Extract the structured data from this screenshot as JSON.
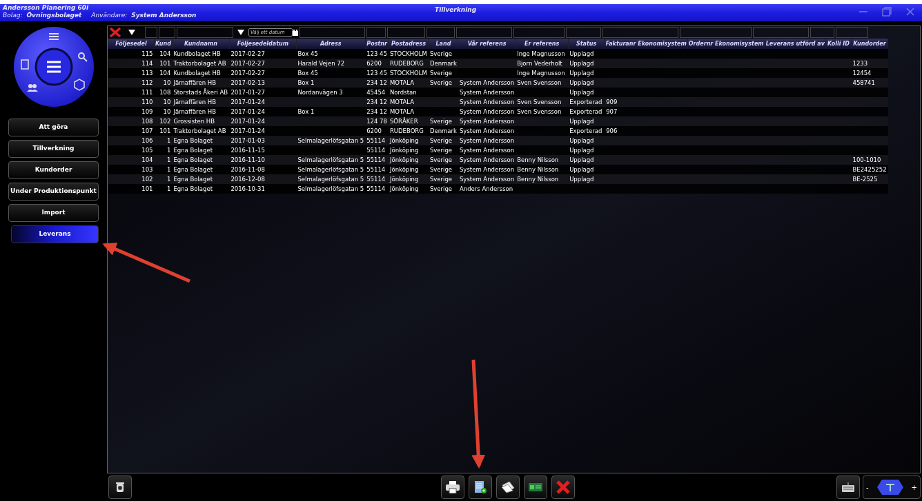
{
  "window": {
    "app_name": "Andersson Planering 60i",
    "company_label": "Bolag:",
    "company": "Övningsbolaget",
    "user_label": "Användare:",
    "user": "System Andersson",
    "title": "Tillverkning"
  },
  "sidebar": {
    "items": [
      {
        "label": "Att göra",
        "selected": false
      },
      {
        "label": "Tillverkning",
        "selected": false
      },
      {
        "label": "Kundorder",
        "selected": false
      },
      {
        "label": "Under Produktionspunkt",
        "selected": false
      },
      {
        "label": "Import",
        "selected": false
      },
      {
        "label": "Leverans",
        "selected": true
      }
    ]
  },
  "filter": {
    "date_placeholder": "Välj ett datum"
  },
  "table": {
    "columns": [
      "Följesedel",
      "Kund",
      "Kundnamn",
      "Följesedeldatum",
      "Adress",
      "Postnr",
      "Postadress",
      "Land",
      "Vår referens",
      "Er referens",
      "Status",
      "Fakturanr Ekonomisystem",
      "Ordernr Ekonomisystem",
      "Leverans utförd av",
      "Kolli ID",
      "Kundorder"
    ],
    "rows": [
      [
        "115",
        "104",
        "Kundbolaget HB",
        "2017-02-27",
        "Box 45",
        "123 45",
        "STOCKHOLM",
        "Sverige",
        "",
        "Inge Magnusson",
        "Upplagd",
        "",
        "",
        "",
        "",
        ""
      ],
      [
        "114",
        "101",
        "Traktorbolaget AB",
        "2017-02-27",
        "Harald Vejen 72",
        "6200",
        "RUDEBORG",
        "Denmark",
        "",
        "Bjorn Vederholt",
        "Upplagd",
        "",
        "",
        "",
        "",
        "1233"
      ],
      [
        "113",
        "104",
        "Kundbolaget HB",
        "2017-02-27",
        "Box 45",
        "123 45",
        "STOCKHOLM",
        "Sverige",
        "",
        "Inge Magnusson",
        "Upplagd",
        "",
        "",
        "",
        "",
        "12454"
      ],
      [
        "112",
        "10",
        "Järnaffären HB",
        "2017-02-13",
        "Box 1",
        "234 12",
        "MOTALA",
        "Sverige",
        "System Andersson",
        "Sven Svensson",
        "Upplagd",
        "",
        "",
        "",
        "",
        "458741"
      ],
      [
        "111",
        "108",
        "Storstads Åkeri AB",
        "2017-01-27",
        "Nordanvägen 3",
        "45454",
        "Nordstan",
        "",
        "System Andersson",
        "",
        "Upplagd",
        "",
        "",
        "",
        "",
        ""
      ],
      [
        "110",
        "10",
        "Järnaffären HB",
        "2017-01-24",
        "",
        "234 12",
        "MOTALA",
        "",
        "System Andersson",
        "Sven Svensson",
        "Exporterad",
        "909",
        "",
        "",
        "",
        ""
      ],
      [
        "109",
        "10",
        "Järnaffären HB",
        "2017-01-24",
        "Box 1",
        "234 12",
        "MOTALA",
        "",
        "System Andersson",
        "Sven Svensson",
        "Exporterad",
        "907",
        "",
        "",
        "",
        ""
      ],
      [
        "108",
        "102",
        "Grossisten HB",
        "2017-01-24",
        "",
        "124 78",
        "SÖRÅKER",
        "Sverige",
        "System Andersson",
        "",
        "Upplagd",
        "",
        "",
        "",
        "",
        ""
      ],
      [
        "107",
        "101",
        "Traktorbolaget AB",
        "2017-01-24",
        "",
        "6200",
        "RUDEBORG",
        "Denmark",
        "System Andersson",
        "",
        "Exporterad",
        "906",
        "",
        "",
        "",
        ""
      ],
      [
        "106",
        "1",
        "Egna Bolaget",
        "2017-01-03",
        "Selmalagerlöfsgatan 5",
        "55114",
        "Jönköping",
        "Sverige",
        "System Andersson",
        "",
        "Upplagd",
        "",
        "",
        "",
        "",
        ""
      ],
      [
        "105",
        "1",
        "Egna Bolaget",
        "2016-11-15",
        "",
        "55114",
        "Jönköping",
        "Sverige",
        "System Andersson",
        "",
        "Upplagd",
        "",
        "",
        "",
        "",
        ""
      ],
      [
        "104",
        "1",
        "Egna Bolaget",
        "2016-11-10",
        "Selmalagerlöfsgatan 5",
        "55114",
        "Jönköping",
        "Sverige",
        "System Andersson",
        "Benny Nilsson",
        "Upplagd",
        "",
        "",
        "",
        "",
        "100-1010"
      ],
      [
        "103",
        "1",
        "Egna Bolaget",
        "2016-11-08",
        "Selmalagerlöfsgatan 5",
        "55114",
        "Jönköping",
        "Sverige",
        "System Andersson",
        "Benny Nilsson",
        "Upplagd",
        "",
        "",
        "",
        "",
        "BE2425252"
      ],
      [
        "102",
        "1",
        "Egna Bolaget",
        "2016-12-08",
        "Selmalagerlöfsgatan 5",
        "55114",
        "Jönköping",
        "Sverige",
        "System Andersson",
        "Benny Nilsson",
        "Upplagd",
        "",
        "",
        "",
        "",
        "BE-2525"
      ],
      [
        "101",
        "1",
        "Egna Bolaget",
        "2016-10-31",
        "Selmalagerlöfsgatan 5",
        "55114",
        "Jönköping",
        "Sverige",
        "Anders Andersson",
        "",
        "",
        "",
        "",
        "",
        "",
        ""
      ]
    ]
  },
  "zoom": {
    "minus": "-",
    "plus": "+"
  }
}
